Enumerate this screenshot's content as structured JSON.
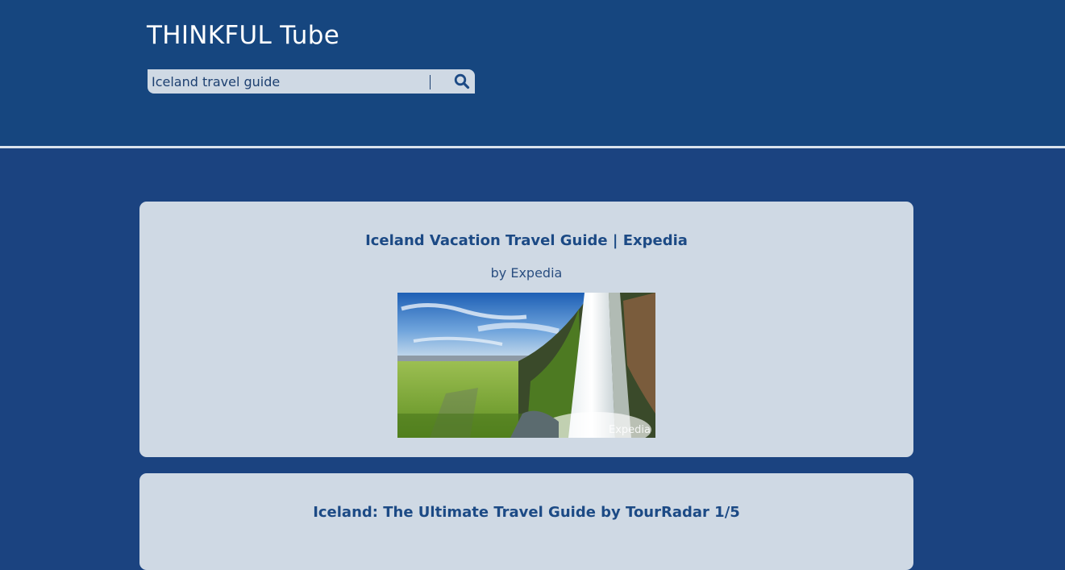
{
  "header": {
    "title": "THINKFUL Tube"
  },
  "search": {
    "value": "Iceland travel guide",
    "button_icon": "search-icon"
  },
  "results": [
    {
      "title": "Iceland Vacation Travel Guide | Expedia",
      "author": "by Expedia",
      "thumbnail_watermark": "Expedia"
    },
    {
      "title": "Iceland: The Ultimate Travel Guide by TourRadar 1/5"
    }
  ],
  "colors": {
    "background": "#1b4380",
    "card": "#cfd9e4",
    "title_text": "#1c4a85",
    "divider": "#d9e2ec"
  }
}
